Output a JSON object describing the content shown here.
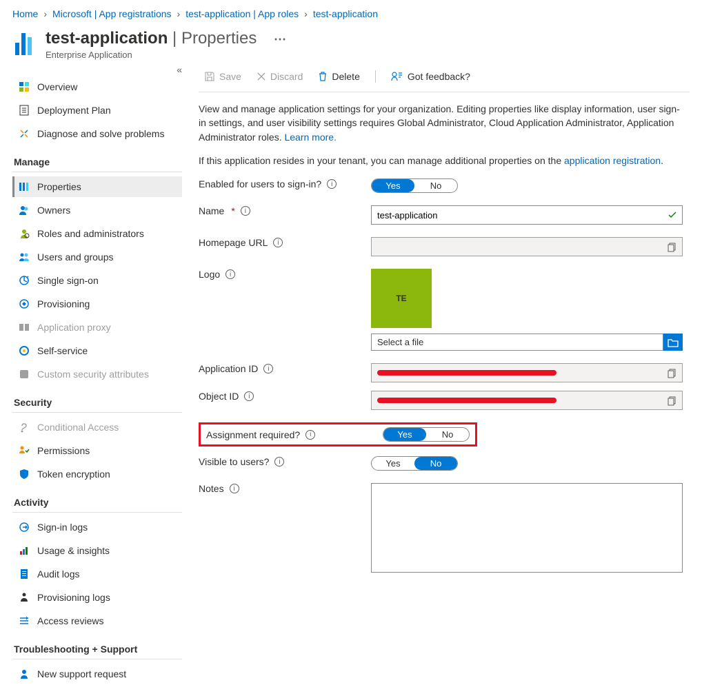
{
  "breadcrumb": [
    {
      "label": "Home"
    },
    {
      "label": "Microsoft | App registrations"
    },
    {
      "label": "test-application | App roles"
    },
    {
      "label": "test-application"
    }
  ],
  "header": {
    "app_name": "test-application",
    "page": "Properties",
    "subtitle": "Enterprise Application"
  },
  "toolbar": {
    "save": "Save",
    "discard": "Discard",
    "delete": "Delete",
    "feedback": "Got feedback?"
  },
  "description": {
    "line1": "View and manage application settings for your organization. Editing properties like display information, user sign-in settings, and user visibility settings requires Global Administrator, Cloud Application Administrator, Application Administrator roles. ",
    "learn_more": "Learn more.",
    "line2_pre": "If this application resides in your tenant, you can manage additional properties on the ",
    "line2_link": "application registration",
    "line2_post": "."
  },
  "sidebar": {
    "top": [
      {
        "icon": "overview",
        "label": "Overview",
        "color": "#0078d4"
      },
      {
        "icon": "deployment",
        "label": "Deployment Plan",
        "color": "#323130"
      },
      {
        "icon": "diagnose",
        "label": "Diagnose and solve problems",
        "color": "#0078d4"
      }
    ],
    "groups": [
      {
        "title": "Manage",
        "items": [
          {
            "icon": "properties",
            "label": "Properties",
            "active": true
          },
          {
            "icon": "owners",
            "label": "Owners"
          },
          {
            "icon": "roles",
            "label": "Roles and administrators"
          },
          {
            "icon": "users-groups",
            "label": "Users and groups"
          },
          {
            "icon": "sso",
            "label": "Single sign-on"
          },
          {
            "icon": "provisioning",
            "label": "Provisioning"
          },
          {
            "icon": "app-proxy",
            "label": "Application proxy",
            "disabled": true
          },
          {
            "icon": "self-service",
            "label": "Self-service"
          },
          {
            "icon": "custom-attr",
            "label": "Custom security attributes",
            "disabled": true
          }
        ]
      },
      {
        "title": "Security",
        "items": [
          {
            "icon": "conditional",
            "label": "Conditional Access",
            "disabled": true
          },
          {
            "icon": "permissions",
            "label": "Permissions"
          },
          {
            "icon": "token",
            "label": "Token encryption"
          }
        ]
      },
      {
        "title": "Activity",
        "items": [
          {
            "icon": "signin",
            "label": "Sign-in logs"
          },
          {
            "icon": "usage",
            "label": "Usage & insights"
          },
          {
            "icon": "audit",
            "label": "Audit logs"
          },
          {
            "icon": "provlogs",
            "label": "Provisioning logs"
          },
          {
            "icon": "access",
            "label": "Access reviews"
          }
        ]
      },
      {
        "title": "Troubleshooting + Support",
        "items": [
          {
            "icon": "support",
            "label": "New support request"
          }
        ]
      }
    ]
  },
  "form": {
    "enabled_label": "Enabled for users to sign-in?",
    "enabled_yes": "Yes",
    "enabled_no": "No",
    "enabled_value": "Yes",
    "name_label": "Name",
    "name_value": "test-application",
    "homepage_label": "Homepage URL",
    "homepage_value": "",
    "logo_label": "Logo",
    "logo_text": "TE",
    "file_placeholder": "Select a file",
    "appid_label": "Application ID",
    "objid_label": "Object ID",
    "assign_label": "Assignment required?",
    "assign_yes": "Yes",
    "assign_no": "No",
    "assign_value": "Yes",
    "visible_label": "Visible to users?",
    "visible_yes": "Yes",
    "visible_no": "No",
    "visible_value": "No",
    "notes_label": "Notes",
    "notes_value": ""
  },
  "icons": {
    "overview": {
      "color": "#0078d4"
    },
    "properties": {
      "color": "#0078d4"
    }
  }
}
